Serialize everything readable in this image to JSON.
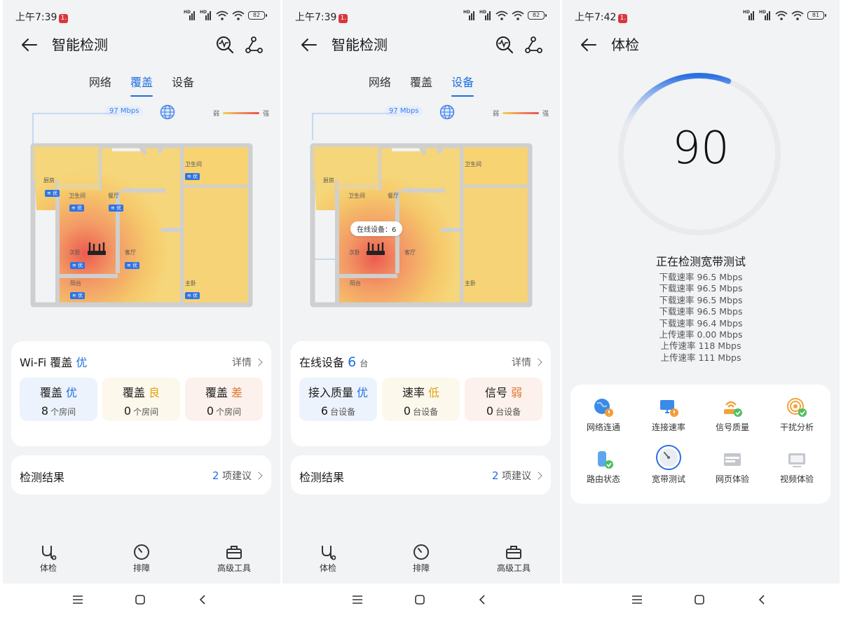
{
  "status": {
    "screen1_time": "上午7:39",
    "screen2_time": "上午7:39",
    "screen3_time": "上午7:42",
    "notif_badge": "1.",
    "signal_label": "HD",
    "screen1_battery": "82",
    "screen2_battery": "82",
    "screen3_battery": "81"
  },
  "screen1": {
    "title": "智能检测",
    "tabs": [
      "网络",
      "覆盖",
      "设备"
    ],
    "active_tab": "覆盖",
    "map": {
      "speed": "97 Mbps",
      "legend_weak": "弱",
      "legend_strong": "强",
      "rooms": [
        "厨房",
        "卫生间",
        "卫生间",
        "餐厅",
        "次卧",
        "客厅",
        "阳台",
        "主卧"
      ],
      "room_badge": "优"
    },
    "coverage_card": {
      "title": "Wi-Fi 覆盖",
      "rating": "优",
      "detail": "详情",
      "items": [
        {
          "label": "覆盖",
          "quality": "优",
          "count": "8",
          "unit": "个房间"
        },
        {
          "label": "覆盖",
          "quality": "良",
          "count": "0",
          "unit": "个房间"
        },
        {
          "label": "覆盖",
          "quality": "差",
          "count": "0",
          "unit": "个房间"
        }
      ]
    },
    "result_card": {
      "title": "检测结果",
      "count": "2",
      "suffix": "项建议"
    }
  },
  "screen2": {
    "title": "智能检测",
    "tabs": [
      "网络",
      "覆盖",
      "设备"
    ],
    "active_tab": "设备",
    "map": {
      "speed": "97 Mbps",
      "legend_weak": "弱",
      "legend_strong": "强",
      "rooms": [
        "厨房",
        "卫生间",
        "卫生间",
        "餐厅",
        "次卧",
        "客厅",
        "阳台",
        "主卧"
      ],
      "online_tooltip": "在线设备：6"
    },
    "devices_card": {
      "title": "在线设备",
      "count": "6",
      "unit": "台",
      "detail": "详情",
      "items": [
        {
          "label": "接入质量",
          "quality": "优",
          "count": "6",
          "unit": "台设备"
        },
        {
          "label": "速率",
          "quality": "低",
          "count": "0",
          "unit": "台设备"
        },
        {
          "label": "信号",
          "quality": "弱",
          "count": "0",
          "unit": "台设备"
        }
      ]
    },
    "result_card": {
      "title": "检测结果",
      "count": "2",
      "suffix": "项建议"
    }
  },
  "bottom_nav": [
    "体检",
    "排障",
    "高级工具"
  ],
  "screen3": {
    "title": "体检",
    "score": "90",
    "progress": 0.12,
    "testing_label": "正在检测宽带测试",
    "log": [
      "下载速率 96.5 Mbps",
      "下载速率 96.5 Mbps",
      "下载速率 96.5 Mbps",
      "下载速率 96.5 Mbps",
      "下载速率 96.4 Mbps",
      "上传速率 0.00 Mbps",
      "上传速率 118 Mbps",
      "上传速率 111 Mbps"
    ],
    "checks": [
      {
        "label": "网络连通",
        "icon": "globe-warning-icon"
      },
      {
        "label": "连接速率",
        "icon": "monitor-warning-icon"
      },
      {
        "label": "信号质量",
        "icon": "router-ok-icon"
      },
      {
        "label": "干扰分析",
        "icon": "interference-ok-icon"
      },
      {
        "label": "路由状态",
        "icon": "router-status-ok-icon"
      },
      {
        "label": "宽带测试",
        "icon": "speedometer-icon"
      },
      {
        "label": "网页体验",
        "icon": "webpage-icon"
      },
      {
        "label": "视频体验",
        "icon": "video-icon"
      }
    ]
  },
  "colors": {
    "accent": "#1e6fe0",
    "good": "#1e6fe0",
    "medium": "#e0a417",
    "poor": "#e0752c",
    "heat_cool": "#f5cf6a",
    "heat_hot": "#ec5b4f"
  }
}
